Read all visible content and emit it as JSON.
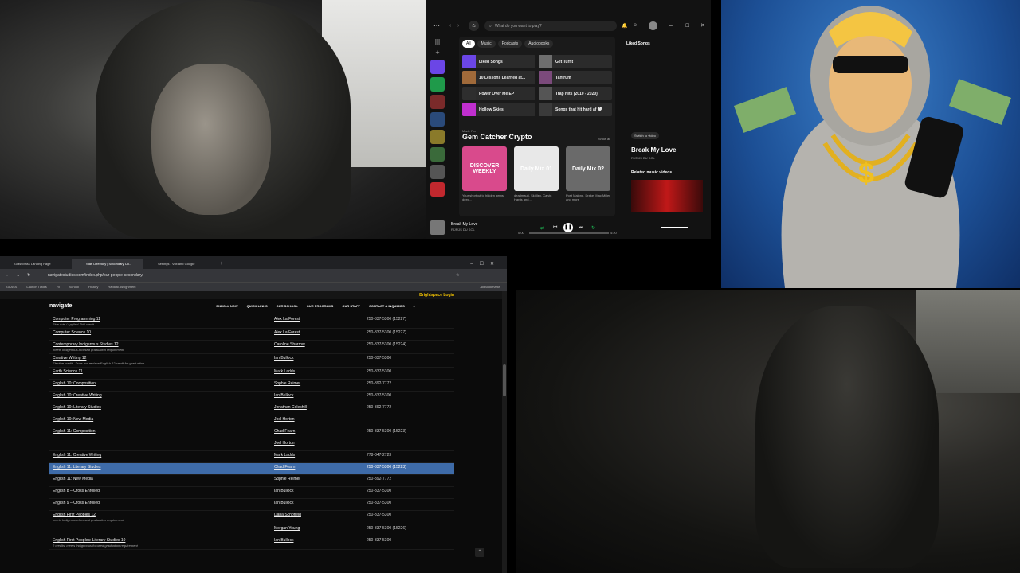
{
  "spotify": {
    "search_placeholder": "What do you want to play?",
    "chips": [
      "All",
      "Music",
      "Podcasts",
      "Audiobooks"
    ],
    "grid": [
      {
        "title": "Liked Songs",
        "color": "#6b46e6"
      },
      {
        "title": "Get Turnt",
        "color": "#6e6e6e"
      },
      {
        "title": "10 Lessons Learned at...",
        "color": "#a06a3a"
      },
      {
        "title": "Tantrum",
        "color": "#7b4a7b"
      },
      {
        "title": "Power Over Me EP",
        "color": "#2e2e2e"
      },
      {
        "title": "Trap Hits (2010 - 2020)",
        "color": "#555555"
      },
      {
        "title": "Hollow Skies",
        "color": "#c02fcf"
      },
      {
        "title": "Songs that hit hard af 🤍",
        "color": "#3a3a3a"
      }
    ],
    "made_for": "Made For",
    "section_title": "Gem Catcher Crypto",
    "show_all": "Show all",
    "cards": [
      {
        "title": "DISCOVER WEEKLY",
        "caption": "Your shortcut to hidden gems, deep...",
        "color": "#d94a8c"
      },
      {
        "title": "Daily Mix 01",
        "caption": "deadmau5, Skrillex, Calvin Harris and...",
        "color": "#e8e8e8"
      },
      {
        "title": "Daily Mix 02",
        "caption": "Post Malone, Drake, Mac Miller and more",
        "color": "#6a6a6a"
      }
    ],
    "right_title": "Liked Songs",
    "switch_video": "Switch to video",
    "track_title": "Break My Love",
    "track_artist": "RÜFÜS DU SOL",
    "related": "Related music videos",
    "now_playing_title": "Break My Love",
    "now_playing_artist": "RÜFÜS DU SOL",
    "time_current": "0:00",
    "time_total": "4:20"
  },
  "browser": {
    "tabs": [
      "GlassMass Landing Page",
      "Staff Directory | Secondary Co...",
      "Settings - Vox and Google"
    ],
    "url": "navigatestudies.com/index.php/our-people-secondary/",
    "bookmarks": [
      "GLASS",
      "Launch Tutors",
      "HI",
      "School",
      "History",
      "Radical Assignment"
    ],
    "all_bookmarks": "All Bookmarks"
  },
  "site": {
    "brightspace": "Brightspace Login",
    "logo": "navigate",
    "nav": [
      "ENROLL NOW",
      "QUICK LINKS",
      "OUR SCHOOL",
      "OUR PROGRAMS",
      "OUR STAFF",
      "CONTACT & INQUIRIES"
    ],
    "rows": [
      {
        "course": "Computer Programming 11",
        "note": "Fine Arts / Applied Skill credit",
        "teacher": "Alex La Forest",
        "phone": "250-337-5300 (15227)",
        "hl": false
      },
      {
        "course": "Computer Science 10",
        "note": "",
        "teacher": "Alex La Forest",
        "phone": "250-337-5300 (15227)",
        "hl": false
      },
      {
        "course": "Contemporary Indigenous Studies 12",
        "note": "meets Indigenous-focused graduation requirement",
        "teacher": "Caroline Sharrow",
        "phone": "250-337-5300 (15224)",
        "hl": false
      },
      {
        "course": "Creative Writing 12",
        "note": "Elective credit - Does not replace English 12 credit for graduation",
        "teacher": "Ian Bullock",
        "phone": "250-337-5300",
        "hl": false
      },
      {
        "course": "Earth Science 11",
        "note": "",
        "teacher": "Mark Ladds",
        "phone": "250-337-5300",
        "hl": false
      },
      {
        "course": "English 10: Composition",
        "note": "",
        "teacher": "Sophie Reimer",
        "phone": "250-392-7772",
        "hl": false
      },
      {
        "course": "English 10: Creative Writing",
        "note": "",
        "teacher": "Ian Bullock",
        "phone": "250-337-5300",
        "hl": false
      },
      {
        "course": "English 10: Literary Studies",
        "note": "",
        "teacher": "Jonathan Coleshill",
        "phone": "250-392-7772",
        "hl": false
      },
      {
        "course": "English 10: New Media",
        "note": "",
        "teacher": "Joel Horton",
        "phone": "",
        "hl": false
      },
      {
        "course": "English 11: Composition",
        "note": "",
        "teacher": "Chad Fearn",
        "phone": "250-337-5300 (15223)",
        "hl": false
      },
      {
        "course": "",
        "note": "",
        "teacher": "Joel Horton",
        "phone": "",
        "hl": false
      },
      {
        "course": "English 11: Creative Writing",
        "note": "",
        "teacher": "Mark Ladds",
        "phone": "778-847-2723",
        "hl": false
      },
      {
        "course": "English 11: Literary Studies",
        "note": "",
        "teacher": "Chad Fearn",
        "phone": "250-337-5300 (15223)",
        "hl": true
      },
      {
        "course": "English 11: New Media",
        "note": "",
        "teacher": "Sophie Reimer",
        "phone": "250-392-7772",
        "hl": false
      },
      {
        "course": "English 8 – Cross Enrolled",
        "note": "",
        "teacher": "Ian Bullock",
        "phone": "250-337-5300",
        "hl": false
      },
      {
        "course": "English 9 – Cross Enrolled",
        "note": "",
        "teacher": "Ian Bullock",
        "phone": "250-337-5300",
        "hl": false
      },
      {
        "course": "English First Peoples 12",
        "note": "meets Indigenous-focused graduation requirement",
        "teacher": "Dana Schofield",
        "phone": "250-337-5300",
        "hl": false
      },
      {
        "course": "",
        "note": "",
        "teacher": "Morgan Young",
        "phone": "250-337-5300 (15226)",
        "hl": false
      },
      {
        "course": "English First Peoples: Literary Studies 10",
        "note": "2 credits; meets Indigenous-focused graduation requirement",
        "teacher": "Ian Bullock",
        "phone": "250-337-5300",
        "hl": false
      }
    ]
  }
}
